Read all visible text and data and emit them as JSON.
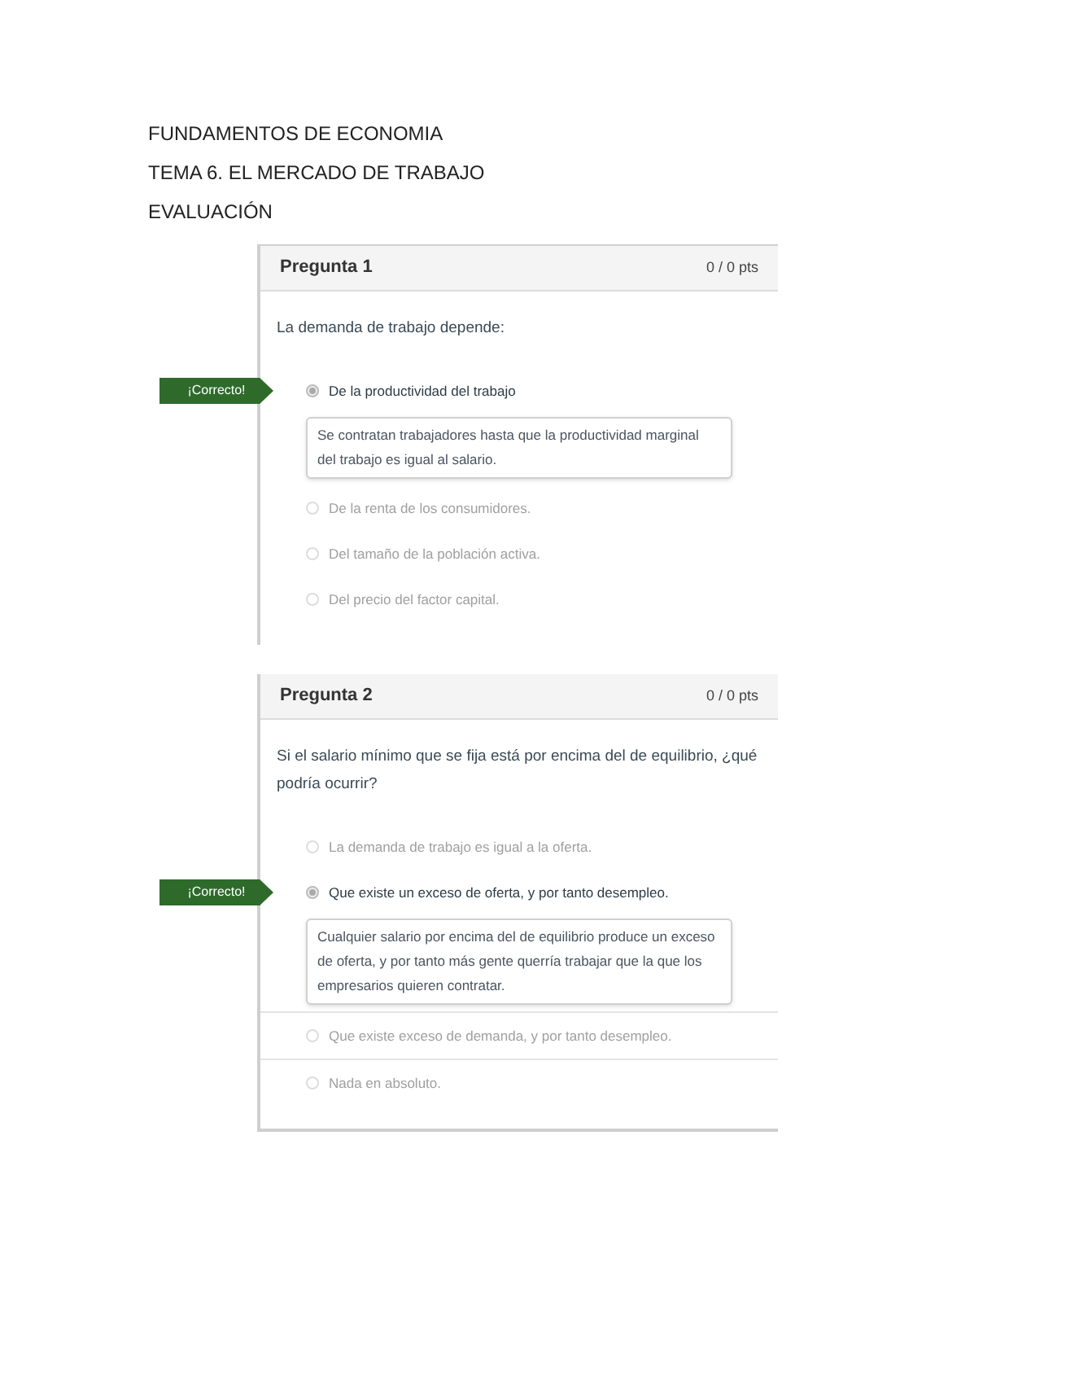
{
  "headings": [
    "FUNDAMENTOS DE ECONOMIA",
    "TEMA 6. EL MERCADO DE TRABAJO",
    "EVALUACIÓN"
  ],
  "questions": [
    {
      "title": "Pregunta 1",
      "points": "0 / 0 pts",
      "text": "La demanda de trabajo depende:",
      "answers": [
        {
          "text": "De la productividad del trabajo",
          "selected": true,
          "flag": "¡Correcto!",
          "feedback": "Se contratan trabajadores hasta que la productividad marginal del trabajo es igual al salario."
        },
        {
          "text": "De la renta de los consumidores.",
          "selected": false
        },
        {
          "text": "Del tamaño de la población activa.",
          "selected": false
        },
        {
          "text": "Del precio del factor capital.",
          "selected": false
        }
      ]
    },
    {
      "title": "Pregunta 2",
      "points": "0 / 0 pts",
      "text": "Si el salario mínimo que se fija está por encima del de equilibrio, ¿qué podría ocurrir?",
      "answers": [
        {
          "text": "La demanda de trabajo es igual a la oferta.",
          "selected": false
        },
        {
          "text": "Que existe un exceso de oferta, y por tanto desempleo.",
          "selected": true,
          "flag": "¡Correcto!",
          "feedback": "Cualquier salario por encima del de equilibrio produce un exceso de oferta, y por tanto más gente querría trabajar que la que los empresarios quieren contratar."
        },
        {
          "text": "Que existe exceso de demanda, y por tanto desempleo.",
          "selected": false
        },
        {
          "text": "Nada en absoluto.",
          "selected": false
        }
      ]
    }
  ]
}
